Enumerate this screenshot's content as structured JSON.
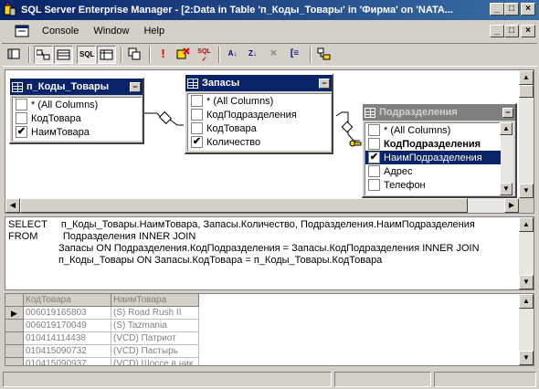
{
  "window": {
    "title": "SQL Server Enterprise Manager - [2:Data in Table 'п_Коды_Товары' in 'Фирма' on 'NATA..."
  },
  "menu": {
    "items": [
      "Console",
      "Window",
      "Help"
    ]
  },
  "toolbar": {
    "buttons": [
      "console-tree-toggle",
      "show-diagram-pane",
      "show-grid-pane",
      "show-sql-pane",
      "show-results-pane",
      "change-query-type",
      "run-query",
      "verify-sql",
      "clear-results",
      "sort-ascending",
      "sort-descending",
      "remove-filter",
      "group-by",
      "add-table"
    ]
  },
  "diagram": {
    "tables": [
      {
        "name": "п_Коды_Товары",
        "active": true,
        "columns": [
          {
            "label": "* (All Columns)",
            "checked": false
          },
          {
            "label": "КодТовара",
            "checked": false
          },
          {
            "label": "НаимТовара",
            "checked": true
          }
        ]
      },
      {
        "name": "Запасы",
        "active": true,
        "columns": [
          {
            "label": "* (All Columns)",
            "checked": false
          },
          {
            "label": "КодПодразделения",
            "checked": false
          },
          {
            "label": "КодТовара",
            "checked": false
          },
          {
            "label": "Количество",
            "checked": true
          }
        ]
      },
      {
        "name": "Подразделения",
        "active": false,
        "columns": [
          {
            "label": "* (All Columns)",
            "checked": false
          },
          {
            "label": "КодПодразделения",
            "checked": false,
            "bold": true
          },
          {
            "label": "НаимПодразделения",
            "checked": true,
            "selected": true
          },
          {
            "label": "Адрес",
            "checked": false
          },
          {
            "label": "Телефон",
            "checked": false
          }
        ]
      }
    ]
  },
  "sql": {
    "lines": [
      "SELECT     п_Коды_Товары.НаимТовара, Запасы.Количество, Подразделения.НаимПодразделения",
      "FROM         Подразделения INNER JOIN",
      "                  Запасы ON Подразделения.КодПодразделения = Запасы.КодПодразделения INNER JOIN",
      "                  п_Коды_Товары ON Запасы.КодТовара = п_Коды_Товары.КодТовара"
    ]
  },
  "results": {
    "columns": [
      "КодТовара",
      "НаимТовара"
    ],
    "rows": [
      [
        "006019165803",
        "(S) Road Rush II"
      ],
      [
        "006019170049",
        "(S) Tazmania"
      ],
      [
        "010414114438",
        "(VCD) Патриот"
      ],
      [
        "010415090732",
        "(VCD) Пастырь"
      ],
      [
        "010415090937",
        "(VCD) Шоссе в ник"
      ]
    ]
  }
}
